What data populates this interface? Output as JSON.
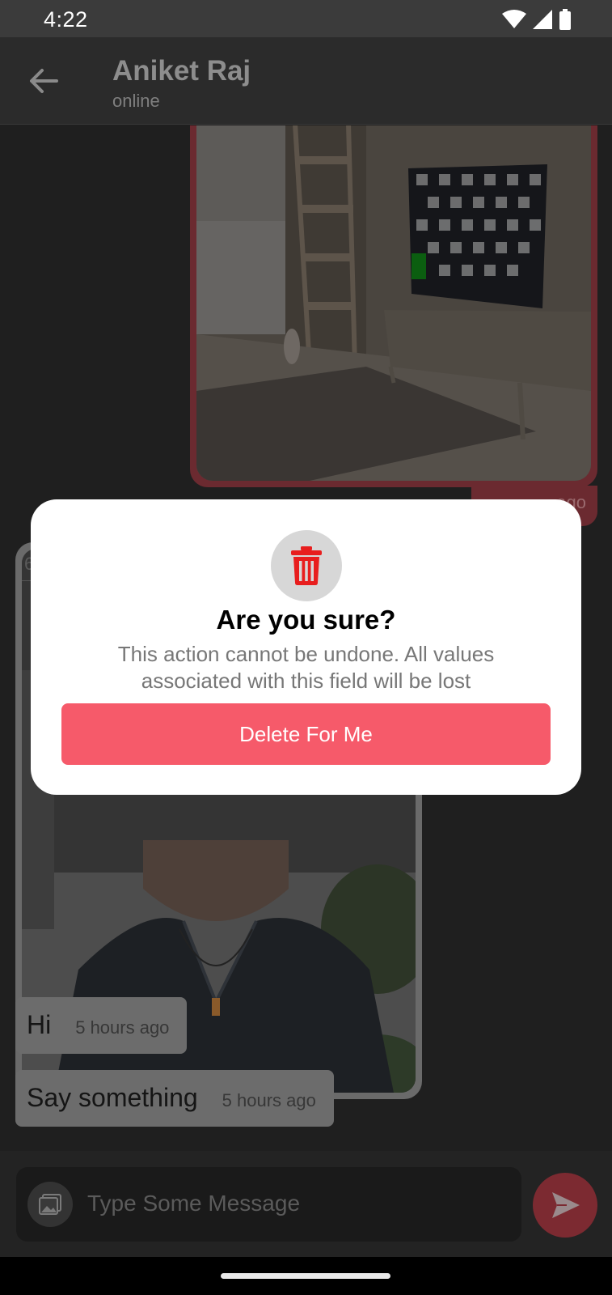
{
  "status_bar": {
    "time": "4:22",
    "icons": [
      "wifi-icon",
      "signal-icon",
      "battery-icon"
    ]
  },
  "header": {
    "contact_name": "Aniket Raj",
    "contact_status": "online"
  },
  "messages": [
    {
      "type": "image",
      "direction": "sent",
      "time": "ago"
    },
    {
      "type": "image",
      "direction": "received",
      "header_text": "6"
    },
    {
      "type": "text",
      "direction": "received",
      "text": "Hi",
      "time": "5 hours ago"
    },
    {
      "type": "text",
      "direction": "received",
      "text": "Say something",
      "time": "5 hours ago"
    }
  ],
  "input": {
    "placeholder": "Type Some Message"
  },
  "dialog": {
    "title": "Are you sure?",
    "message": "This action cannot be undone. All values associated with this field will be lost",
    "delete_button": "Delete For Me"
  },
  "colors": {
    "accent": "#f65a6a",
    "delete_icon": "#e81e1e",
    "sent_bubble": "#6b2a30"
  }
}
